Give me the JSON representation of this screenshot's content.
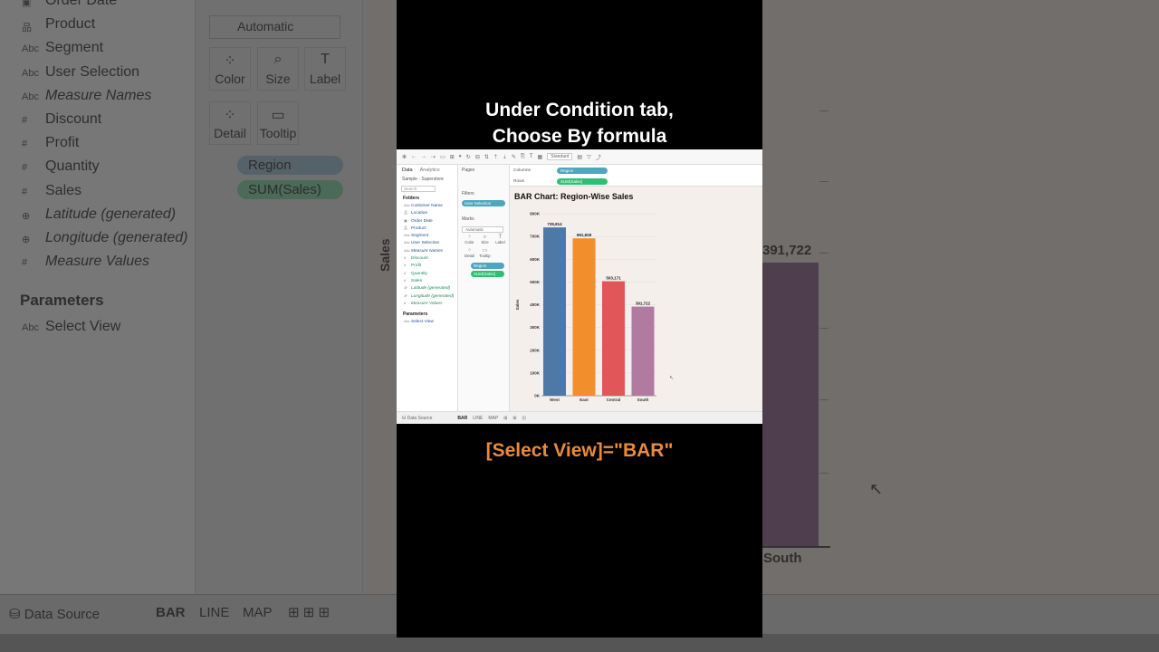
{
  "background": {
    "fields": [
      {
        "type": "calendar",
        "label": "Order Date",
        "italic": false
      },
      {
        "type": "hierarchy",
        "label": "Product",
        "italic": false
      },
      {
        "type": "Abc",
        "label": "Segment",
        "italic": false
      },
      {
        "type": "Abc",
        "label": "User Selection",
        "italic": false
      },
      {
        "type": "Abc",
        "label": "Measure Names",
        "italic": true
      },
      {
        "type": "#",
        "label": "Discount",
        "italic": false
      },
      {
        "type": "#",
        "label": "Profit",
        "italic": false
      },
      {
        "type": "#",
        "label": "Quantity",
        "italic": false
      },
      {
        "type": "#",
        "label": "Sales",
        "italic": false
      },
      {
        "type": "globe",
        "label": "Latitude (generated)",
        "italic": true
      },
      {
        "type": "globe",
        "label": "Longitude (generated)",
        "italic": true
      },
      {
        "type": "#",
        "label": "Measure Values",
        "italic": true
      }
    ],
    "parameters_heading": "Parameters",
    "parameter_item": "Select View",
    "parameter_type": "Abc",
    "marks_type": "Automatic",
    "marks_cards": [
      "Color",
      "Size",
      "Label",
      "Detail",
      "Tooltip"
    ],
    "pill_region": "Region",
    "pill_sales": "SUM(Sales)",
    "axis_label": "Sales",
    "bar_value": "391,722",
    "bar_category": "South",
    "data_source": "Data Source",
    "sheet_tabs": [
      "BAR",
      "LINE",
      "MAP"
    ]
  },
  "caption": {
    "line1": "Under Condition tab,",
    "line2": "Choose By formula",
    "formula": "[Select View]=\"BAR\""
  },
  "tableau": {
    "toolbar": {
      "fit_select": "Standard"
    },
    "data_tab": "Data",
    "analytics_tab": "Analytics",
    "source": "Sample - Superstore",
    "search_placeholder": "Search",
    "folders_heading": "Folders",
    "fields": [
      {
        "type": "Abc",
        "label": "Customer Name",
        "measure": false,
        "italic": false
      },
      {
        "type": "hier",
        "label": "Location",
        "measure": false,
        "italic": false
      },
      {
        "type": "cal",
        "label": "Order Date",
        "measure": false,
        "italic": false
      },
      {
        "type": "hier",
        "label": "Product",
        "measure": false,
        "italic": false
      },
      {
        "type": "Abc",
        "label": "Segment",
        "measure": false,
        "italic": false
      },
      {
        "type": "Abc",
        "label": "User Selection",
        "measure": false,
        "italic": false
      },
      {
        "type": "Abc",
        "label": "Measure Names",
        "measure": false,
        "italic": true
      },
      {
        "type": "#",
        "label": "Discount",
        "measure": true,
        "italic": false
      },
      {
        "type": "#",
        "label": "Profit",
        "measure": true,
        "italic": false
      },
      {
        "type": "#",
        "label": "Quantity",
        "measure": true,
        "italic": false
      },
      {
        "type": "#",
        "label": "Sales",
        "measure": true,
        "italic": false
      },
      {
        "type": "geo",
        "label": "Latitude (generated)",
        "measure": true,
        "italic": true
      },
      {
        "type": "geo",
        "label": "Longitude (generated)",
        "measure": true,
        "italic": true
      },
      {
        "type": "#",
        "label": "Measure Values",
        "measure": true,
        "italic": true
      }
    ],
    "parameters_heading": "Parameters",
    "parameter_item": "Select View",
    "pages_label": "Pages",
    "filters_label": "Filters",
    "filter_pill": "User Selection",
    "marks_label": "Marks",
    "marks_type": "Automatic",
    "marks_cards": [
      "Color",
      "Size",
      "Label",
      "Detail",
      "Tooltip"
    ],
    "marks_pill_region": "Region",
    "marks_pill_sales": "SUM(Sales)",
    "columns_label": "Columns",
    "rows_label": "Rows",
    "columns_pill": "Region",
    "rows_pill": "SUM(Sales)",
    "status_source": "Data Source",
    "sheet_tabs": [
      "BAR",
      "LINE",
      "MAP"
    ]
  },
  "chart_data": {
    "type": "bar",
    "title": "BAR Chart: Region-Wise Sales",
    "xlabel": "",
    "ylabel": "Sales",
    "categories": [
      "West",
      "East",
      "Central",
      "South"
    ],
    "values": [
      739814,
      691828,
      503171,
      391722
    ],
    "value_labels": [
      "739,814",
      "691,828",
      "503,171",
      "391,722"
    ],
    "colors": [
      "#4e79a7",
      "#f28e2b",
      "#e15759",
      "#b07aa1"
    ],
    "yticks": [
      "0K",
      "100K",
      "200K",
      "300K",
      "400K",
      "500K",
      "600K",
      "700K",
      "800K"
    ],
    "ylim": [
      0,
      800000
    ],
    "grid": true
  },
  "colors": {
    "pill_dimension": "#4ea6bf",
    "pill_measure": "#2fbf71",
    "formula_text": "#e98b3c",
    "viz_background": "#f5efeb"
  }
}
